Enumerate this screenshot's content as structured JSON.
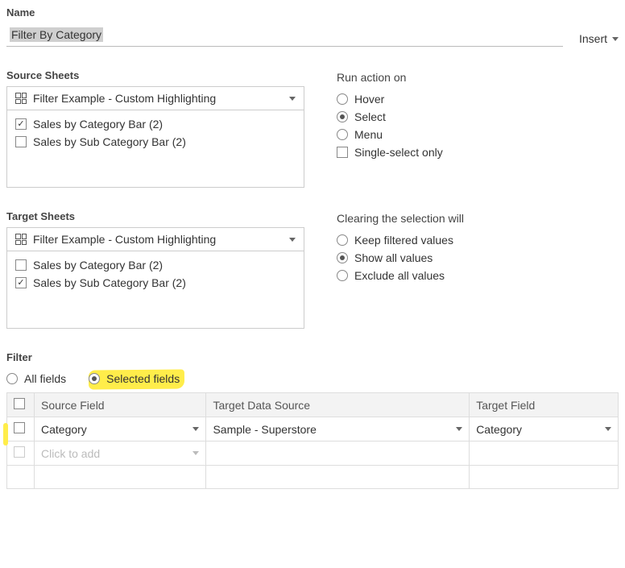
{
  "name": {
    "label": "Name",
    "value": "Filter By Category",
    "insert_label": "Insert"
  },
  "source_sheets": {
    "label": "Source Sheets",
    "dropdown_value": "Filter Example - Custom Highlighting",
    "items": [
      {
        "label": "Sales by Category Bar (2)",
        "checked": true
      },
      {
        "label": "Sales by Sub Category Bar (2)",
        "checked": false
      }
    ]
  },
  "run_action": {
    "label": "Run action on",
    "options": {
      "hover": "Hover",
      "select": "Select",
      "menu": "Menu"
    },
    "selected": "select",
    "single_select": {
      "label": "Single-select only",
      "checked": false
    }
  },
  "target_sheets": {
    "label": "Target Sheets",
    "dropdown_value": "Filter Example - Custom Highlighting",
    "items": [
      {
        "label": "Sales by Category Bar (2)",
        "checked": false
      },
      {
        "label": "Sales by Sub Category Bar (2)",
        "checked": true
      }
    ]
  },
  "clearing": {
    "label": "Clearing the selection will",
    "options": {
      "keep": "Keep filtered values",
      "show": "Show all values",
      "exclude": "Exclude all values"
    },
    "selected": "show"
  },
  "filter": {
    "label": "Filter",
    "all_fields": "All fields",
    "selected_fields": "Selected fields",
    "mode": "selected",
    "columns": {
      "source_field": "Source Field",
      "target_ds": "Target Data Source",
      "target_field": "Target Field"
    },
    "rows": [
      {
        "checked": false,
        "source_field": "Category",
        "target_ds": "Sample - Superstore",
        "target_field": "Category"
      }
    ],
    "add_placeholder": "Click to add"
  }
}
